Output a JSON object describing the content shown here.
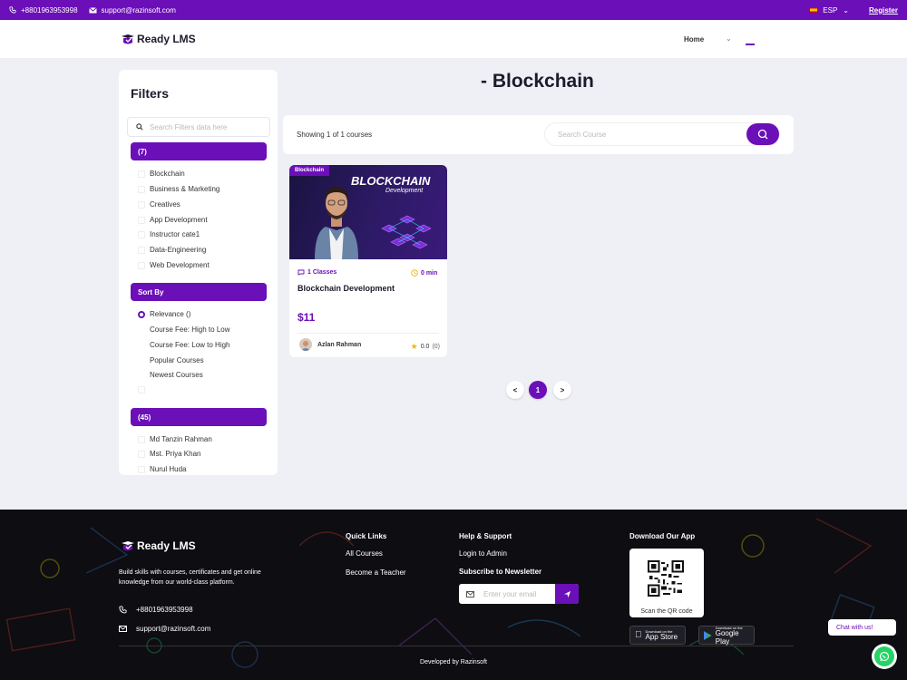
{
  "topbar": {
    "phone": "+8801963953998",
    "email": "support@razinsoft.com",
    "language": "ESP",
    "register": "Register"
  },
  "header": {
    "logo": "Ready LMS",
    "nav_home": "Home"
  },
  "filters": {
    "title": "Filters",
    "search_placeholder": "Search Filters data here",
    "categories_header": "(7)",
    "categories": [
      "Blockchain",
      "Business & Marketing",
      "Creatives",
      "App Development",
      "Instructor cate1",
      "Data-Engineering",
      "Web Development"
    ],
    "sort_header": "Sort By",
    "sort_options": [
      "Relevance ()",
      "Course Fee: High to Low",
      "Course Fee: Low to High",
      "Popular Courses",
      "Newest Courses"
    ],
    "instructors_header": "(45)",
    "instructors": [
      "Md Tanzin Rahman",
      "Mst. Priya Khan",
      "Nurul Huda"
    ]
  },
  "main": {
    "title": "- Blockchain",
    "showing": "Showing 1 of 1 courses",
    "search_placeholder": "Search Course"
  },
  "course": {
    "tag": "Blockchain",
    "banner_title": "BLOCKCHAIN",
    "banner_sub": "Development",
    "classes": "1 Classes",
    "duration": "0 min",
    "title": "Blockchain Development",
    "price": "$11",
    "author": "Azlan Rahman",
    "rating": "0.0",
    "reviews": "(0)"
  },
  "pagination": {
    "prev": "<",
    "current": "1",
    "next": ">"
  },
  "footer": {
    "logo": "Ready LMS",
    "description": "Build skills with courses, certificates and get online knowledge from our world-class platform.",
    "phone": "+8801963953998",
    "email": "support@razinsoft.com",
    "quick_links_title": "Quick Links",
    "quick_links": [
      "All Courses",
      "Become a Teacher"
    ],
    "help_title": "Help & Support",
    "help_links": [
      "Login to Admin"
    ],
    "newsletter_title": "Subscribe to Newsletter",
    "newsletter_placeholder": "Enter your email",
    "app_title": "Download Our App",
    "qr_caption": "Scan the QR code",
    "app_store_small": "Download on the",
    "app_store": "App Store",
    "google_play_small": "Download on the",
    "google_play": "Google Play",
    "developed_by": "Developed by Razinsoft"
  },
  "chat": {
    "label": "Chat with us!"
  },
  "colors": {
    "brand": "#6b0fb8",
    "footer_bg": "#0d0d12",
    "star": "#f5b400",
    "whatsapp": "#25d366"
  }
}
